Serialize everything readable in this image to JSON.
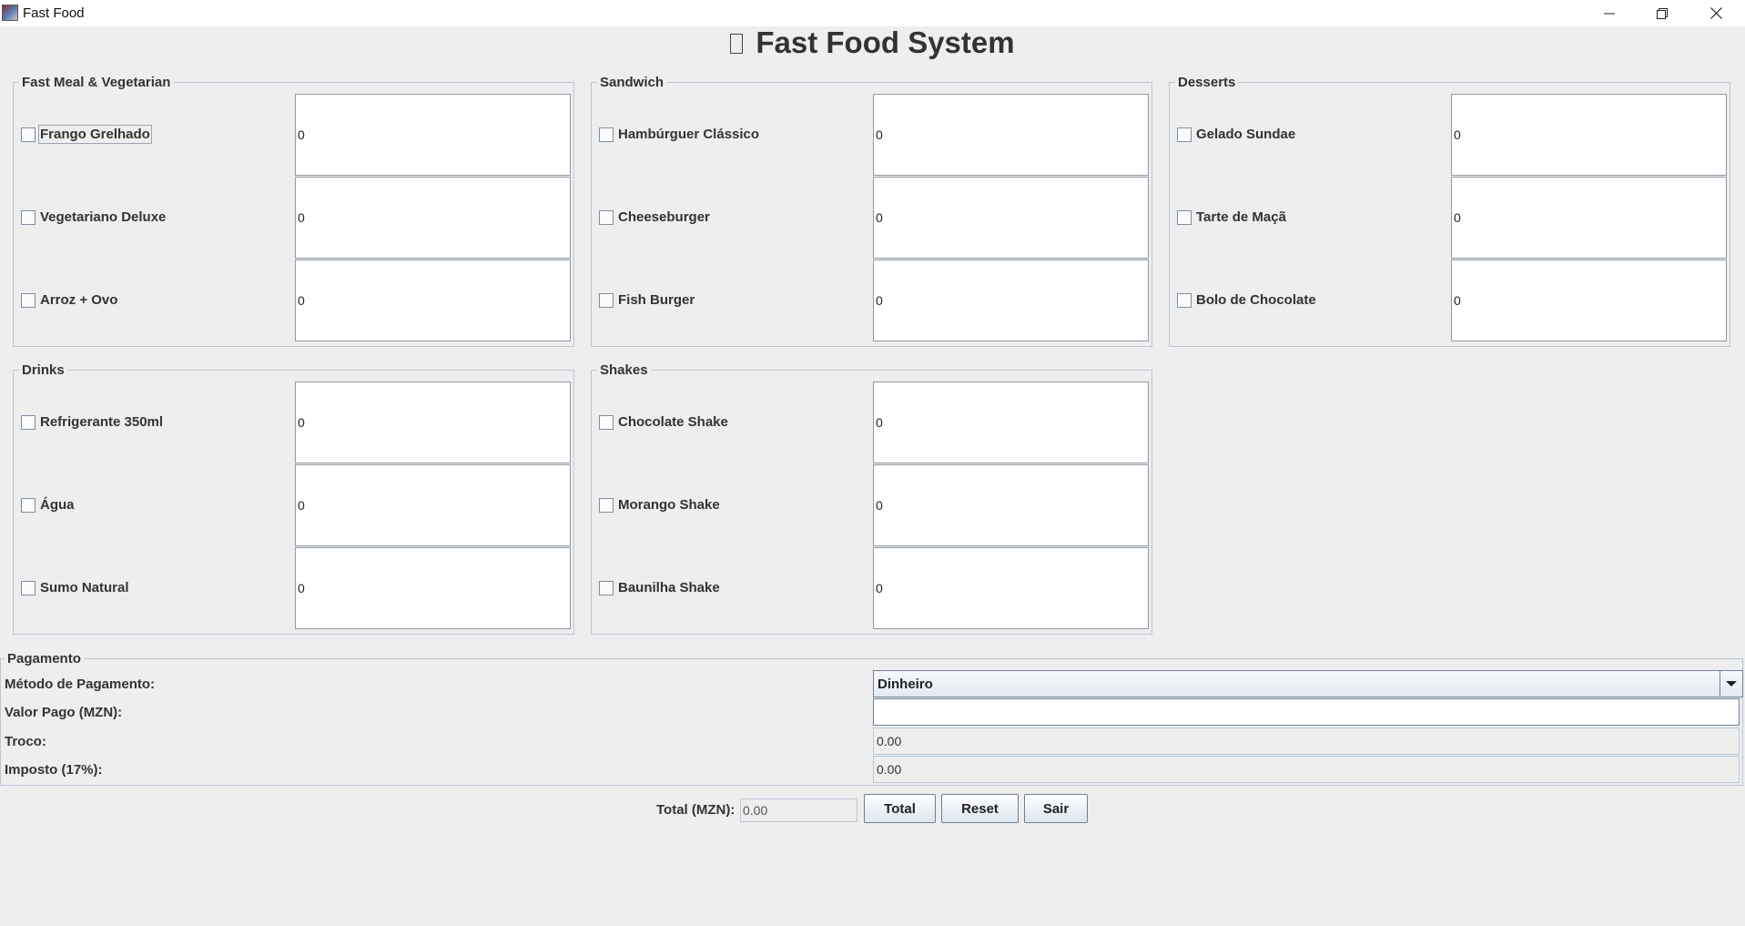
{
  "window": {
    "title": "Fast Food",
    "app_icon": "fast-food-app-icon",
    "controls": [
      "minimize-icon",
      "restore-icon",
      "close-icon"
    ]
  },
  "heading": "Fast Food System",
  "groups": {
    "fast_meal": {
      "title": "Fast Meal & Vegetarian",
      "items": [
        {
          "label": "Frango Grelhado",
          "qty": "0",
          "checked": false
        },
        {
          "label": "Vegetariano Deluxe",
          "qty": "0",
          "checked": false
        },
        {
          "label": "Arroz + Ovo",
          "qty": "0",
          "checked": false
        }
      ]
    },
    "sandwich": {
      "title": "Sandwich",
      "items": [
        {
          "label": "Hambúrguer Clássico",
          "qty": "0",
          "checked": false
        },
        {
          "label": "Cheeseburger",
          "qty": "0",
          "checked": false
        },
        {
          "label": "Fish Burger",
          "qty": "0",
          "checked": false
        }
      ]
    },
    "desserts": {
      "title": "Desserts",
      "items": [
        {
          "label": "Gelado Sundae",
          "qty": "0",
          "checked": false
        },
        {
          "label": "Tarte de Maçã",
          "qty": "0",
          "checked": false
        },
        {
          "label": "Bolo de Chocolate",
          "qty": "0",
          "checked": false
        }
      ]
    },
    "drinks": {
      "title": "Drinks",
      "items": [
        {
          "label": "Refrigerante 350ml",
          "qty": "0",
          "checked": false
        },
        {
          "label": "Água",
          "qty": "0",
          "checked": false
        },
        {
          "label": "Sumo Natural",
          "qty": "0",
          "checked": false
        }
      ]
    },
    "shakes": {
      "title": "Shakes",
      "items": [
        {
          "label": "Chocolate Shake",
          "qty": "0",
          "checked": false
        },
        {
          "label": "Morango Shake",
          "qty": "0",
          "checked": false
        },
        {
          "label": "Baunilha Shake",
          "qty": "0",
          "checked": false
        }
      ]
    }
  },
  "payment": {
    "title": "Pagamento",
    "method_label": "Método de Pagamento:",
    "method_value": "Dinheiro",
    "paid_label": "Valor Pago (MZN):",
    "paid_value": "",
    "change_label": "Troco:",
    "change_value": "0.00",
    "tax_label": "Imposto (17%):",
    "tax_value": "0.00"
  },
  "footer": {
    "total_label": "Total (MZN):",
    "total_value": "0.00",
    "total_button": "Total",
    "reset_button": "Reset",
    "exit_button": "Sair"
  }
}
